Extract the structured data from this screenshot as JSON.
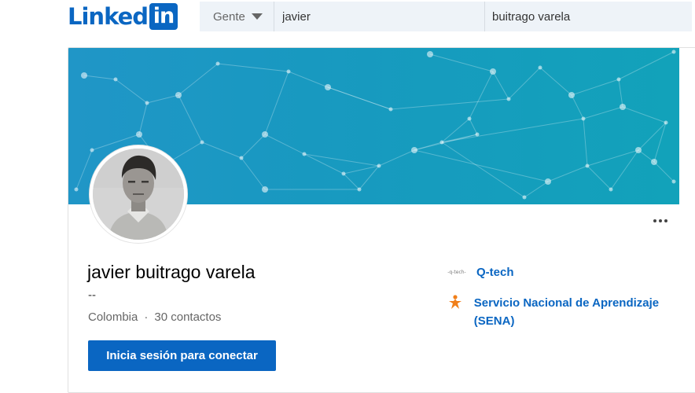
{
  "header": {
    "logo_text": "Linked",
    "logo_in": "in",
    "search": {
      "filter_label": "Gente",
      "first_name_value": "javier",
      "last_name_value": "buitrago varela"
    }
  },
  "profile": {
    "name": "javier buitrago varela",
    "headline": "--",
    "location": "Colombia",
    "separator": "·",
    "connections": "30 contactos",
    "connect_button_label": "Inicia sesión para conectar",
    "more_menu_icon": "ellipsis-icon",
    "organizations": [
      {
        "name": "Q-tech",
        "logo_text": "-q-tech-",
        "icon": "q-tech-logo"
      },
      {
        "name": "Servicio Nacional de Aprendizaje (SENA)",
        "icon": "sena-logo"
      }
    ]
  },
  "colors": {
    "brand": "#0a66c2",
    "search_bg": "#eef3f8",
    "banner_start": "#2096c7",
    "banner_end": "#12a2ba",
    "sena_orange": "#f07f1a"
  }
}
